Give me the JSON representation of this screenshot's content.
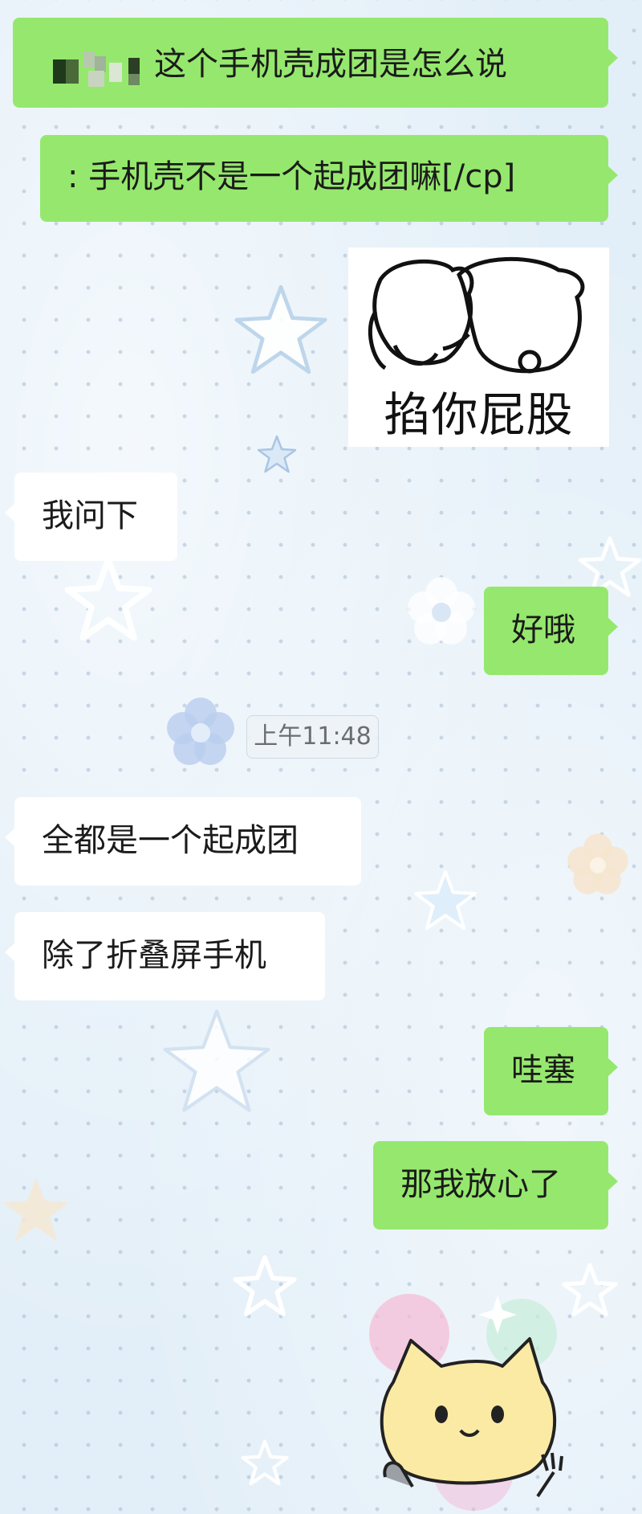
{
  "messages": [
    {
      "side": "out",
      "text": "这个手机壳成团是怎么说"
    },
    {
      "side": "out",
      "text": ": 手机壳不是一个起成团嘛[/cp]"
    },
    {
      "side": "out",
      "type": "sticker",
      "caption": "掐你屁股"
    },
    {
      "side": "in",
      "text": "我问下"
    },
    {
      "side": "out",
      "text": "好哦"
    },
    {
      "side": "in",
      "text": "全都是一个起成团"
    },
    {
      "side": "in",
      "text": "除了折叠屏手机"
    },
    {
      "side": "out",
      "text": "哇塞"
    },
    {
      "side": "out",
      "text": "那我放心了"
    },
    {
      "side": "out",
      "type": "sticker",
      "name": "yellow-cat-sticker"
    }
  ],
  "timestamp": "上午11:48",
  "colors": {
    "outgoing_bubble": "#95e86d",
    "incoming_bubble": "#ffffff",
    "background": "#e3eff8"
  }
}
